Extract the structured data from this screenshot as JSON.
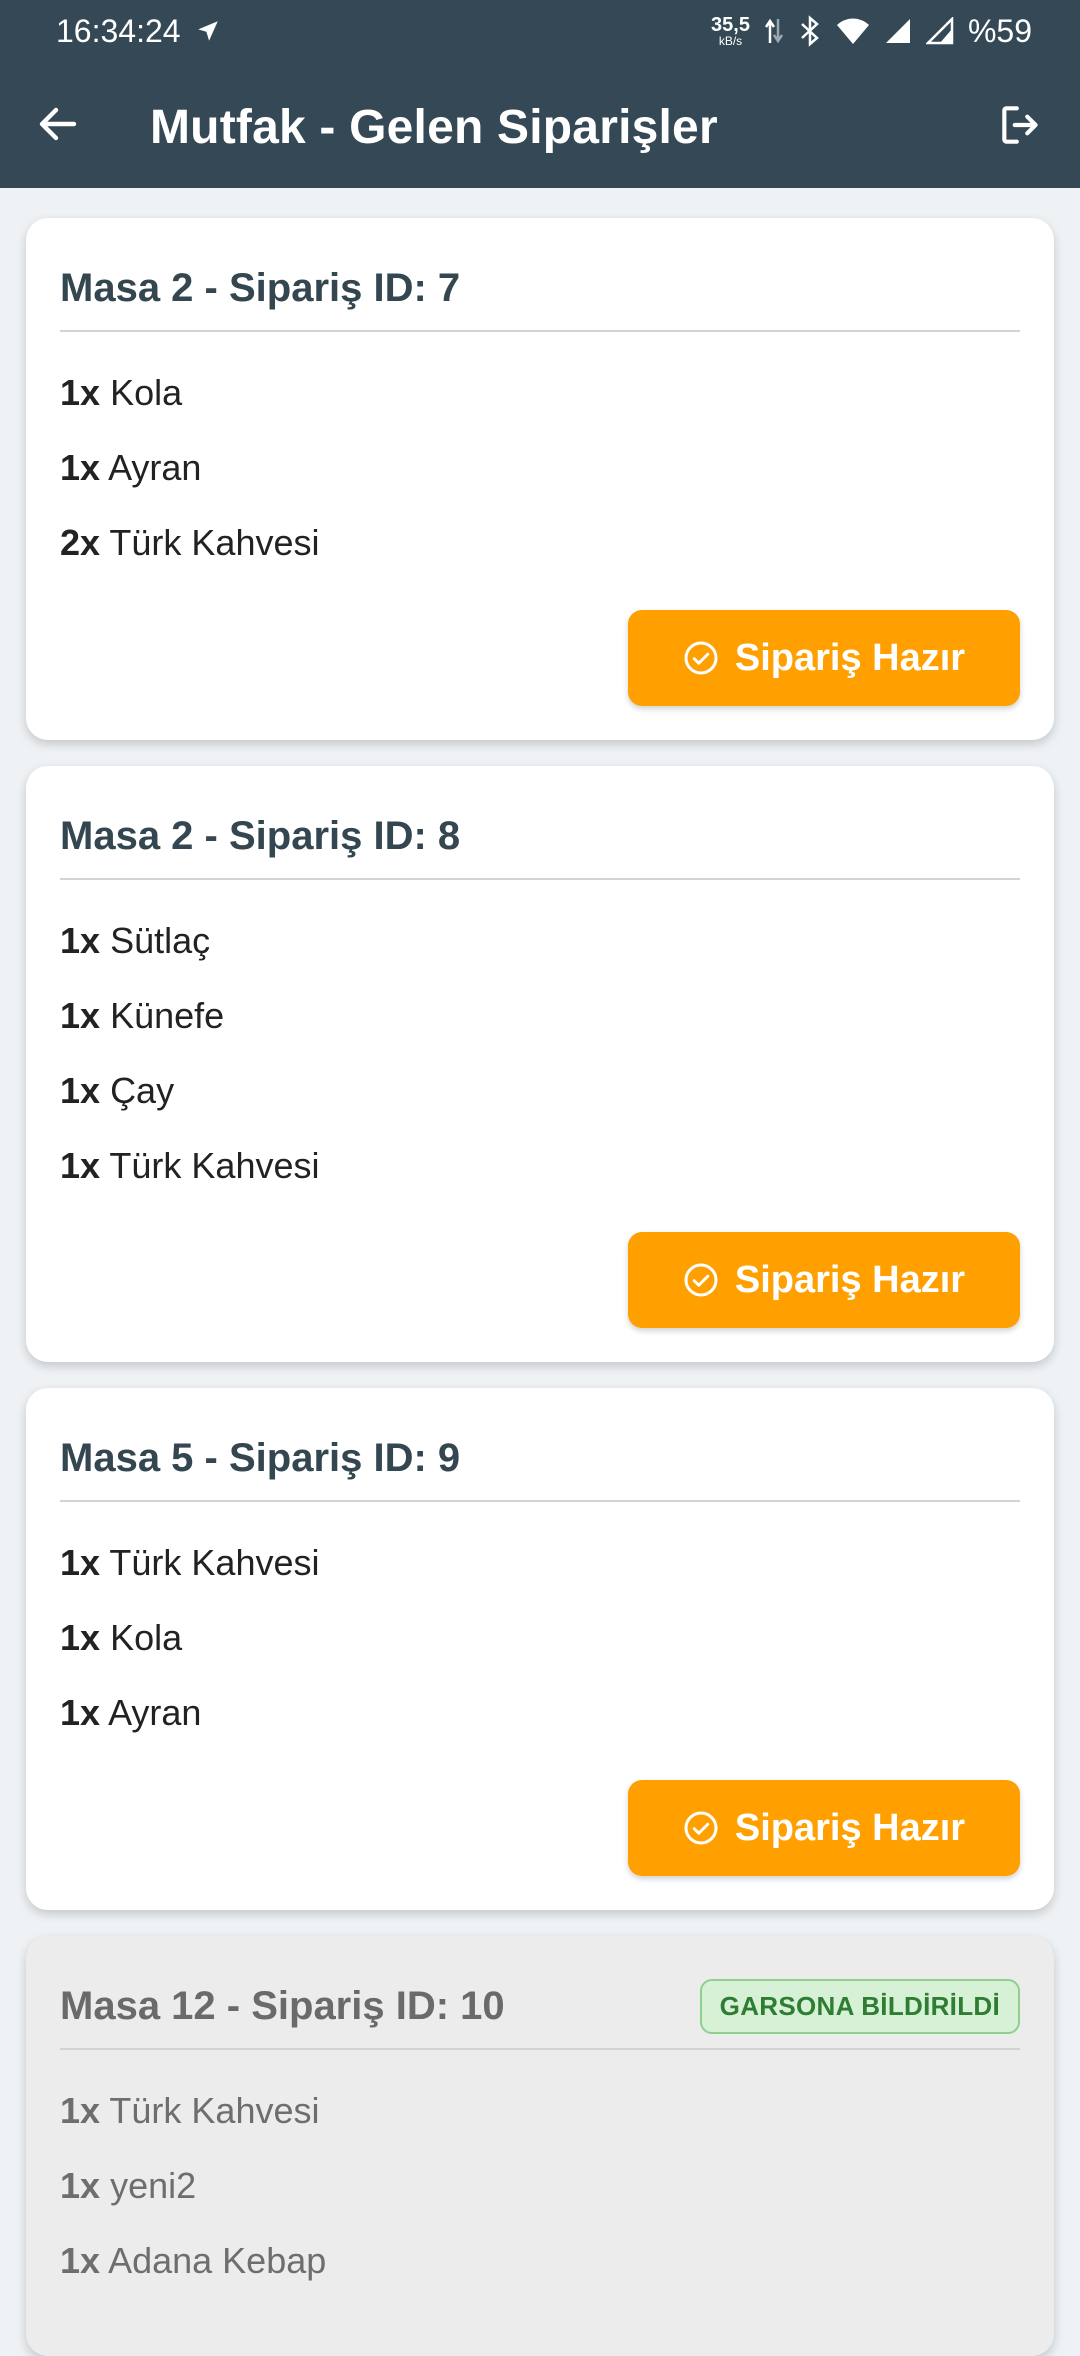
{
  "status_bar": {
    "time": "16:34:24",
    "net_speed": "35,5",
    "net_unit": "kB/s",
    "battery": "%59"
  },
  "app_bar": {
    "title": "Mutfak - Gelen Siparişler",
    "back_icon": "arrow-left-icon",
    "logout_icon": "logout-icon"
  },
  "orders": [
    {
      "title": "Masa 2 - Sipariş ID: 7",
      "items": [
        {
          "qty": "1x",
          "name": "Kola"
        },
        {
          "qty": "1x",
          "name": "Ayran"
        },
        {
          "qty": "2x",
          "name": "Türk Kahvesi"
        }
      ],
      "button_label": "Sipariş Hazır"
    },
    {
      "title": "Masa 2 - Sipariş ID: 8",
      "items": [
        {
          "qty": "1x",
          "name": "Sütlaç"
        },
        {
          "qty": "1x",
          "name": "Künefe"
        },
        {
          "qty": "1x",
          "name": "Çay"
        },
        {
          "qty": "1x",
          "name": "Türk Kahvesi"
        }
      ],
      "button_label": "Sipariş Hazır"
    },
    {
      "title": "Masa 5 - Sipariş ID: 9",
      "items": [
        {
          "qty": "1x",
          "name": "Türk Kahvesi"
        },
        {
          "qty": "1x",
          "name": "Kola"
        },
        {
          "qty": "1x",
          "name": "Ayran"
        }
      ],
      "button_label": "Sipariş Hazır"
    },
    {
      "title": "Masa 12 - Sipariş ID: 10",
      "badge": "GARSONA BİLDİRİLDİ",
      "items": [
        {
          "qty": "1x",
          "name": "Türk Kahvesi"
        },
        {
          "qty": "1x",
          "name": "yeni2"
        },
        {
          "qty": "1x",
          "name": "Adana Kebap"
        }
      ]
    }
  ],
  "colors": {
    "appbar": "#344955",
    "accent": "#ff9f00",
    "badge_bg": "#d6f1d6",
    "badge_text": "#2e7d32"
  }
}
